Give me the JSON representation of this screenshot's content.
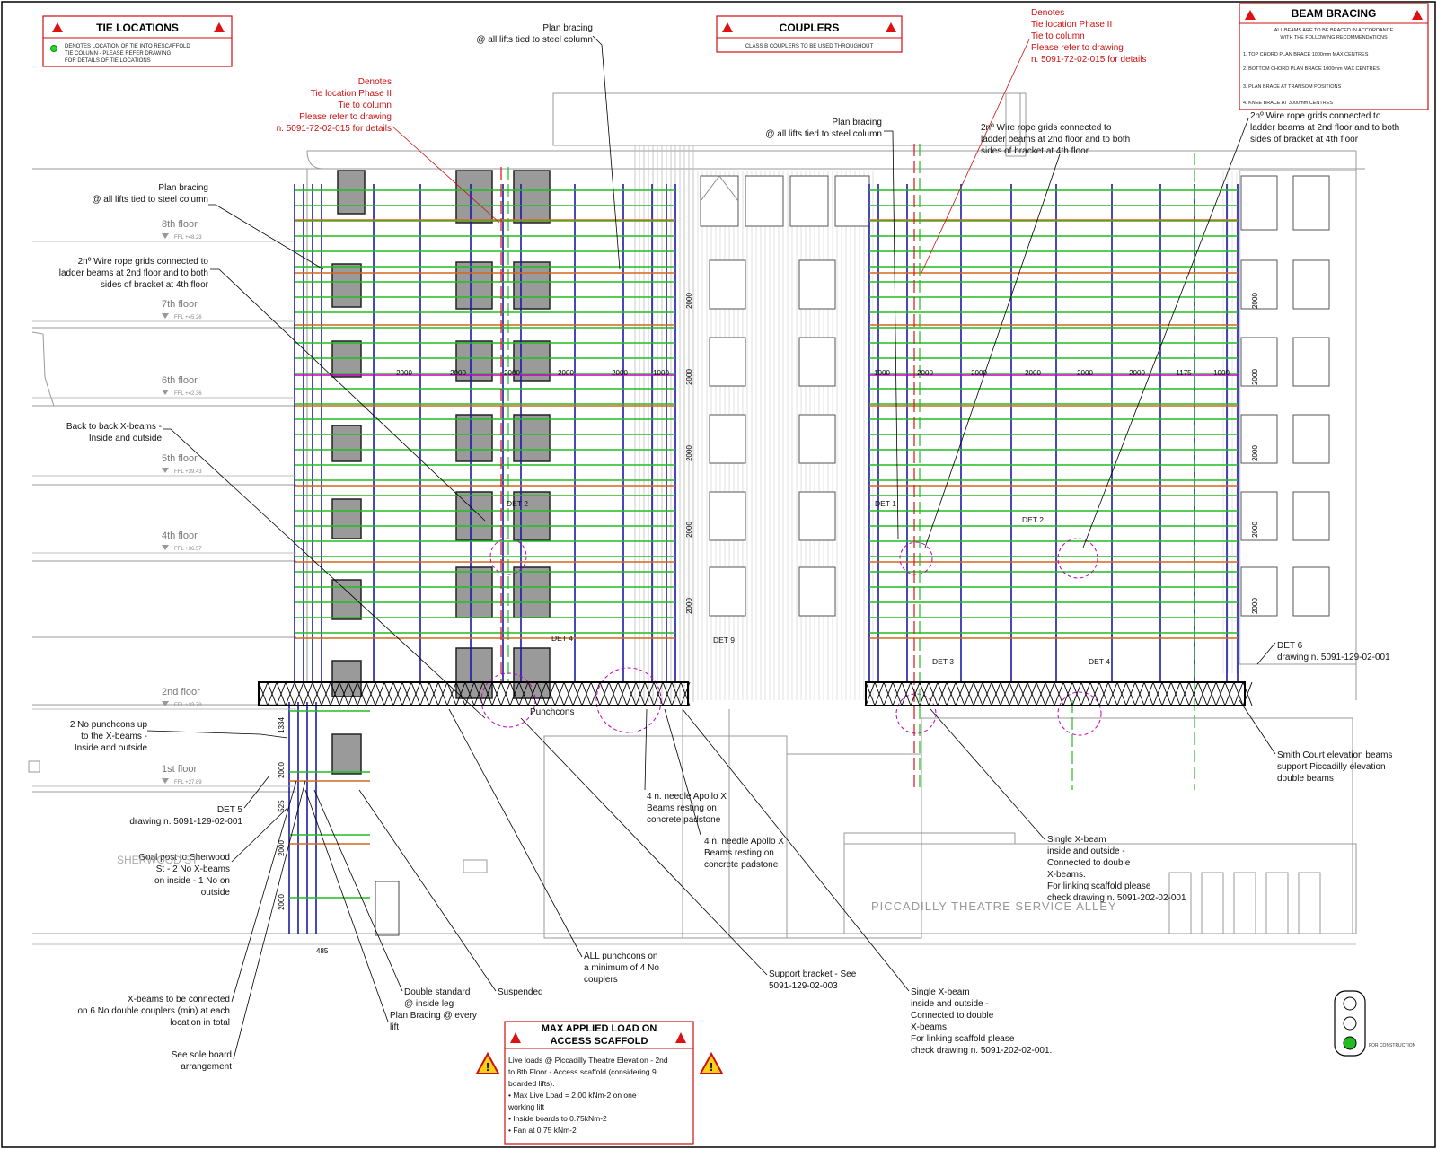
{
  "legend_boxes": {
    "tie_locations": {
      "title": "TIE LOCATIONS",
      "lines": [
        "DENOTES LOCATION OF TIE INTO RESCAFFOLD",
        "TIE COLUMN - PLEASE REFER DRAWING",
        "FOR DETAILS OF TIE LOCATIONS"
      ]
    },
    "couplers": {
      "title": "COUPLERS",
      "lines": [
        "CLASS B COUPLERS TO BE USED THROUGHOUT"
      ]
    },
    "beam_bracing": {
      "title": "BEAM BRACING",
      "lines": [
        "ALL BEAMS ARE TO BE BRACED IN ACCORDANCE",
        "WITH THE FOLLOWING RECOMMENDATIONS",
        "1. TOP CHORD PLAN BRACE 1000mm MAX CENTRES",
        "2. BOTTOM CHORD PLAN BRACE 1000mm MAX CENTRES",
        "3. PLAN BRACE AT TRANSOM POSITIONS",
        "4. KNEE BRACE AT 3000mm CENTRES"
      ]
    }
  },
  "floors": [
    {
      "label": "8th floor",
      "level": "FFL +48.23"
    },
    {
      "label": "7th floor",
      "level": "FFL +45.26"
    },
    {
      "label": "6th floor",
      "level": "FFL +42.36"
    },
    {
      "label": "5th floor",
      "level": "FFL +39.43"
    },
    {
      "label": "4th floor",
      "level": "FFL +36.57"
    },
    {
      "label": "2nd floor",
      "level": "FFL +33.78"
    },
    {
      "label": "1st floor",
      "level": "FFL +27.89"
    }
  ],
  "notes": {
    "plan_bracing_1": [
      "Plan bracing",
      "@ all lifts tied to steel column"
    ],
    "plan_bracing_2": [
      "Plan bracing",
      "@ all lifts tied to steel column"
    ],
    "plan_bracing_3": [
      "Plan bracing",
      "@ all lifts tied to steel column"
    ],
    "denotes_left": [
      "Denotes",
      "Tie location Phase II",
      "Tie to column",
      "Please refer to drawing",
      "n. 5091-72-02-015 for details"
    ],
    "denotes_right": [
      "Denotes",
      "Tie location Phase II",
      "Tie to column",
      "Please refer to drawing",
      "n. 5091-72-02-015 for details"
    ],
    "wire_rope_left": [
      "2nº Wire rope grids connected to",
      "ladder beams at 2nd floor and to both",
      "sides of bracket at 4th floor"
    ],
    "wire_rope_mid": [
      "2nº Wire rope grids connected to",
      "ladder beams at 2nd floor and to both",
      "sides of bracket at 4th floor"
    ],
    "wire_rope_right": [
      "2nº Wire rope grids connected to",
      "ladder beams at 2nd floor and to both",
      "sides of bracket at 4th floor"
    ],
    "back_to_back": [
      "Back to back X-beams -",
      "Inside and outside"
    ],
    "punchcons_up": [
      "2 No punchcons up",
      "to the X-beams -",
      "Inside and outside"
    ],
    "det5": [
      "DET 5",
      "drawing n. 5091-129-02-001"
    ],
    "goal_post": [
      "Goal post to Sherwood",
      "St - 2 No X-beams",
      "on inside - 1 No on",
      "outside"
    ],
    "xbeams_connected": [
      "X-beams to be connected",
      "on 6 No double couplers (min) at each",
      "location in total"
    ],
    "sole_board": [
      "See sole board",
      "arrangement"
    ],
    "double_standard": [
      "Double standard",
      "@ inside leg"
    ],
    "plan_bracing_lift": [
      "Plan Bracing @ every",
      "lift"
    ],
    "suspended": [
      "Suspended"
    ],
    "all_punchcons": [
      "ALL punchcons on",
      "a minimum of 4 No",
      "couplers"
    ],
    "needle_1": [
      "4 n. needle Apollo X",
      "Beams resting on",
      "concrete padstone"
    ],
    "needle_2": [
      "4 n. needle Apollo X",
      "Beams resting on",
      "concrete padstone"
    ],
    "support_bracket": [
      "Support bracket - See",
      "5091-129-02-003"
    ],
    "single_xbeam_1": [
      "Single X-beam",
      "inside and outside -",
      "Connected to double",
      "X-beams.",
      "For linking scaffold please",
      "check drawing n. 5091-202-02-001"
    ],
    "single_xbeam_2": [
      "Single X-beam",
      "inside and outside -",
      "Connected to double",
      "X-beams.",
      "For linking scaffold please",
      "check drawing n. 5091-202-02-001."
    ],
    "smith_court": [
      "Smith Court elevation beams",
      "support Piccadilly elevation",
      "double beams"
    ],
    "det6": [
      "DET 6",
      "drawing n. 5091-129-02-001"
    ],
    "punchcons_label": [
      "Punchcons"
    ]
  },
  "det_labels": [
    "DET 1",
    "DET 2",
    "DET 3",
    "DET 4",
    "DET 4",
    "DET 9",
    "DET 2"
  ],
  "dimensions": {
    "left_run": [
      "2000",
      "2000",
      "2000",
      "2000",
      "2000",
      "1000"
    ],
    "right_run": [
      "1000",
      "2000",
      "2000",
      "2000",
      "2000",
      "2000",
      "1175",
      "1000"
    ],
    "vertical": [
      "2000",
      "2000",
      "2000",
      "2000",
      "2000"
    ],
    "lower_vertical": [
      "1334",
      "2000",
      "525",
      "2000",
      "2000"
    ],
    "base": [
      "485"
    ]
  },
  "street_labels": {
    "alley": "PICCADILLY THEATRE SERVICE ALLEY",
    "sherwood": "SHERWOOD ST"
  },
  "max_load": {
    "title_1": "MAX APPLIED LOAD ON",
    "title_2": "ACCESS SCAFFOLD",
    "lines": [
      "Live loads @ Piccadilly Theatre Elevation - 2nd",
      "to 8th Floor - Access scaffold (considering 9",
      "boarded lifts).",
      "•      Max Live Load = 2.00 kNm-2 on one",
      "working lift",
      "•      Inside boards to 0.75kNm-2",
      "•      Fan at 0.75 kNm-2"
    ]
  },
  "traffic_light_label": "FOR CONSTRUCTION",
  "colors": {
    "green": "#22bb22",
    "blue": "#1a1aaa",
    "orange": "#d2691e",
    "magenta": "#c000c0",
    "red": "#dd1111",
    "grey": "#888888"
  }
}
